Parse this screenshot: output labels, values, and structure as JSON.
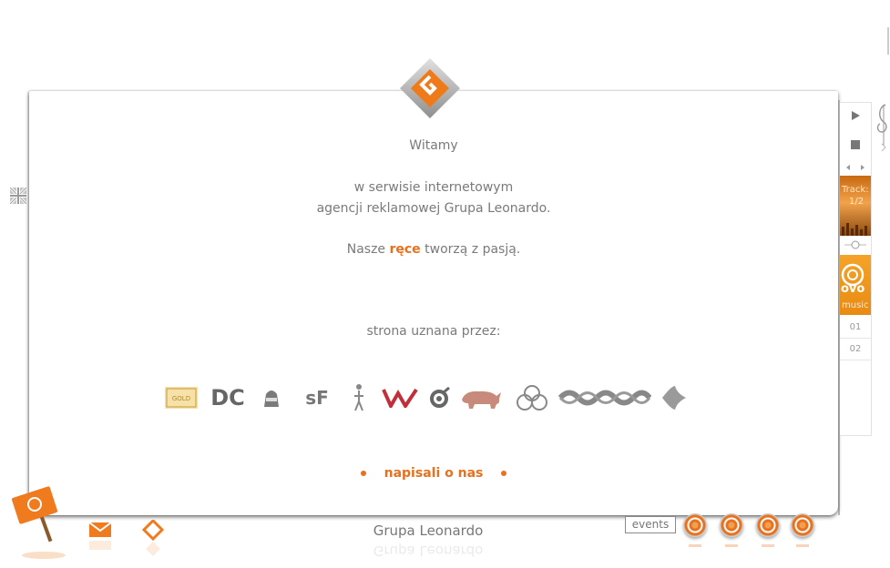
{
  "intro": {
    "greeting": "Witamy",
    "line1": "w serwisie internetowym",
    "line2": "agencji reklamowej Grupa Leonardo.",
    "slogan_pre": "Nasze ",
    "slogan_hl": "ręce",
    "slogan_post": " tworzą z pasją."
  },
  "awards": {
    "heading": "strona uznana przez:",
    "items": [
      {
        "name": "GOLD AWARD",
        "label": "GOLD"
      },
      {
        "name": "DC",
        "label": "DC"
      },
      {
        "name": "Heads",
        "label": ""
      },
      {
        "name": "sF",
        "label": "sF"
      },
      {
        "name": "figure",
        "label": ""
      },
      {
        "name": "W",
        "label": ""
      },
      {
        "name": "O",
        "label": ""
      },
      {
        "name": "rhino",
        "label": ""
      },
      {
        "name": "circles",
        "label": ""
      },
      {
        "name": "ornament",
        "label": ""
      },
      {
        "name": "drop",
        "label": ""
      }
    ]
  },
  "link": {
    "napisali": "napisali o nas"
  },
  "player": {
    "track_label": "Track:",
    "track_num": "1/2",
    "ovo_label": "ovo",
    "music_label": "music",
    "items": [
      "01",
      "02"
    ]
  },
  "footer": {
    "title": "Grupa Leonardo",
    "events": "events"
  },
  "colors": {
    "accent": "#e8711e",
    "text": "#7a7a7a"
  }
}
